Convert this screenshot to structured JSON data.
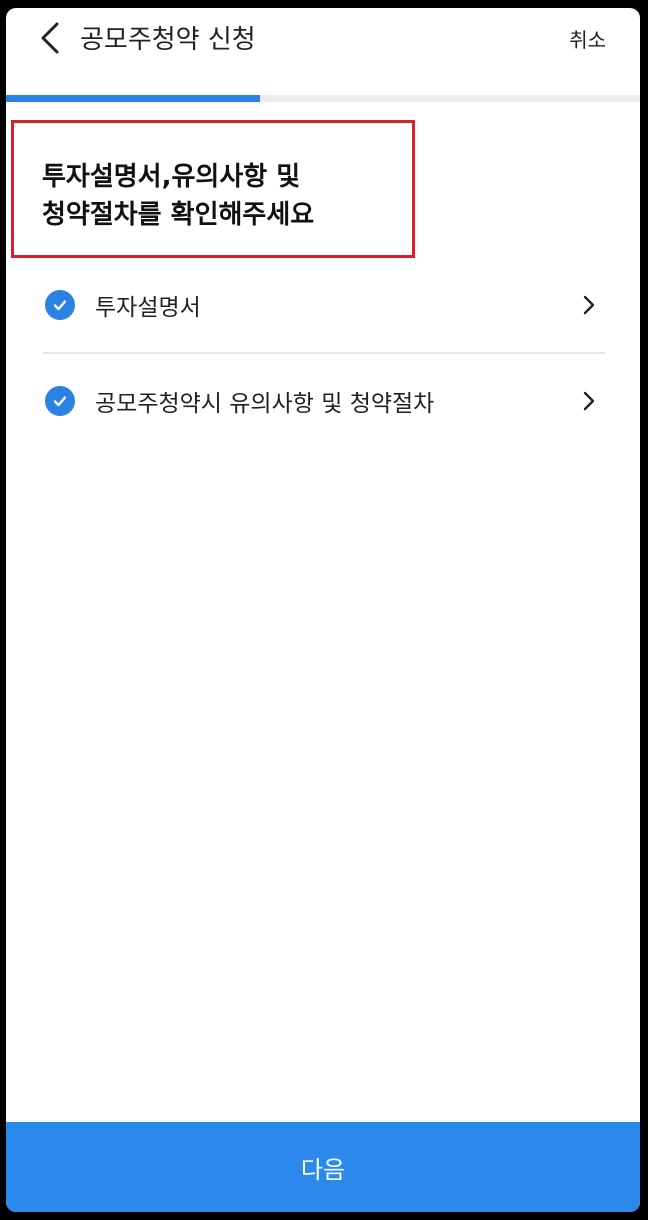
{
  "header": {
    "title": "공모주청약 신청",
    "cancel_label": "취소",
    "back_icon": "chevron-left-icon"
  },
  "progress": {
    "fraction": 0.4
  },
  "headline": {
    "line1": "투자설명서,유의사항 및",
    "line2": "청약절차를 확인해주세요"
  },
  "items": [
    {
      "label": "투자설명서",
      "checked": true,
      "icon": "check-circle-icon"
    },
    {
      "label": "공모주청약시 유의사항 및 청약절차",
      "checked": true,
      "icon": "check-circle-icon"
    }
  ],
  "footer": {
    "next_label": "다음"
  },
  "colors": {
    "accent": "#2a82e4",
    "button": "#2a89ea",
    "highlight_border": "#d9202c"
  }
}
